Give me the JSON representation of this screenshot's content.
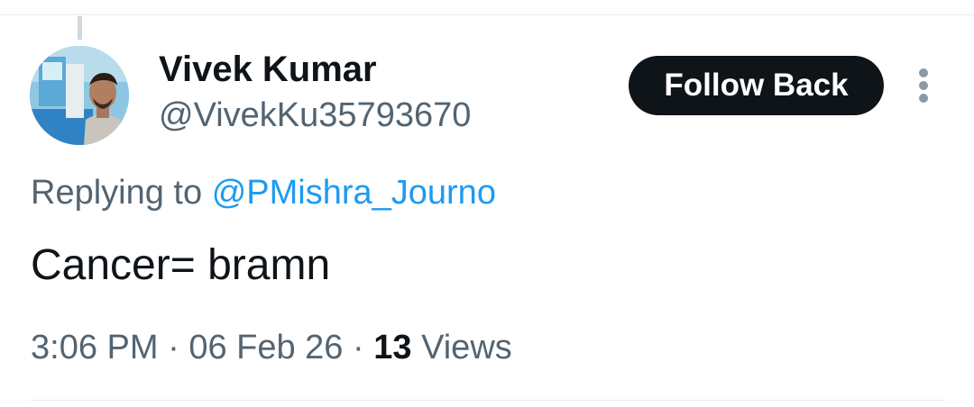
{
  "author": {
    "display_name": "Vivek Kumar",
    "handle": "@VivekKu35793670",
    "avatar_icon": "profile-photo"
  },
  "actions": {
    "follow_label": "Follow Back",
    "more_icon": "more-vertical-icon"
  },
  "reply": {
    "prefix": "Replying to",
    "mention": "@PMishra_Journo"
  },
  "tweet": {
    "text": "Cancer= bramn"
  },
  "meta": {
    "time": "3:06 PM",
    "separator": "·",
    "date": "06 Feb 26",
    "views_count": "13",
    "views_label": "Views"
  },
  "colors": {
    "text_primary": "#0f1419",
    "text_secondary": "#536471",
    "link": "#1d9bf0",
    "button_bg": "#0f1419",
    "divider": "#e6ecf0"
  }
}
